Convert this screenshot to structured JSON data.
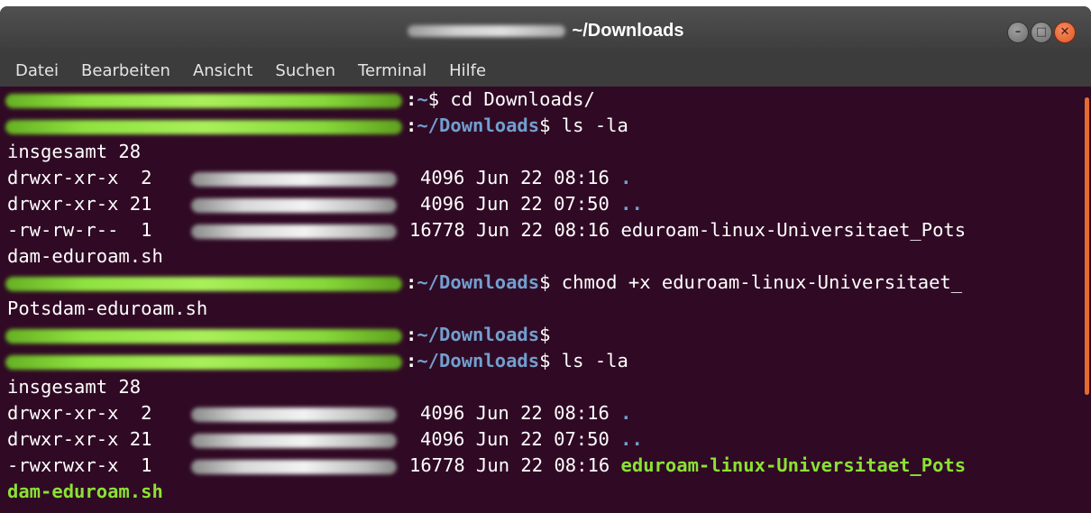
{
  "window": {
    "title": "~/Downloads",
    "controls": {
      "minimize": "–",
      "maximize": "□",
      "close": "✕"
    }
  },
  "menu": [
    "Datei",
    "Bearbeiten",
    "Ansicht",
    "Suchen",
    "Terminal",
    "Hilfe"
  ],
  "colors": {
    "background": "#300a24",
    "prompt_user": "#8ae234",
    "path": "#729fcf",
    "executable": "#8ae234",
    "scrollbar": "#e46c2e"
  },
  "terminal": {
    "prompt_sep": ":",
    "prompt_home": "~",
    "prompt_dir": "~/Downloads",
    "prompt_sign": "$",
    "cmd1": " cd Downloads/",
    "cmd2": " ls -la",
    "cmd3": " chmod +x eduroam-linux-Universitaet_",
    "cmd3_wrap": "Potsdam-eduroam.sh",
    "cmd5": " ls -la",
    "total1": "insgesamt 28",
    "rows1": [
      {
        "perm": "drwxr-xr-x  2",
        "meta": "4096 Jun 22 08:16",
        "name": "."
      },
      {
        "perm": "drwxr-xr-x 21",
        "meta": "4096 Jun 22 07:50",
        "name": ".."
      },
      {
        "perm": "-rw-rw-r--  1",
        "meta": "16778 Jun 22 08:16",
        "name": "eduroam-linux-Universitaet_Pots"
      }
    ],
    "wrap1": "dam-eduroam.sh",
    "total2": "insgesamt 28",
    "rows2": [
      {
        "perm": "drwxr-xr-x  2",
        "meta": "4096 Jun 22 08:16",
        "name": "."
      },
      {
        "perm": "drwxr-xr-x 21",
        "meta": "4096 Jun 22 07:50",
        "name": ".."
      },
      {
        "perm": "-rwxrwxr-x  1",
        "meta": "16778 Jun 22 08:16",
        "name": "eduroam-linux-Universitaet_Pots"
      }
    ],
    "wrap2": "dam-eduroam.sh"
  }
}
